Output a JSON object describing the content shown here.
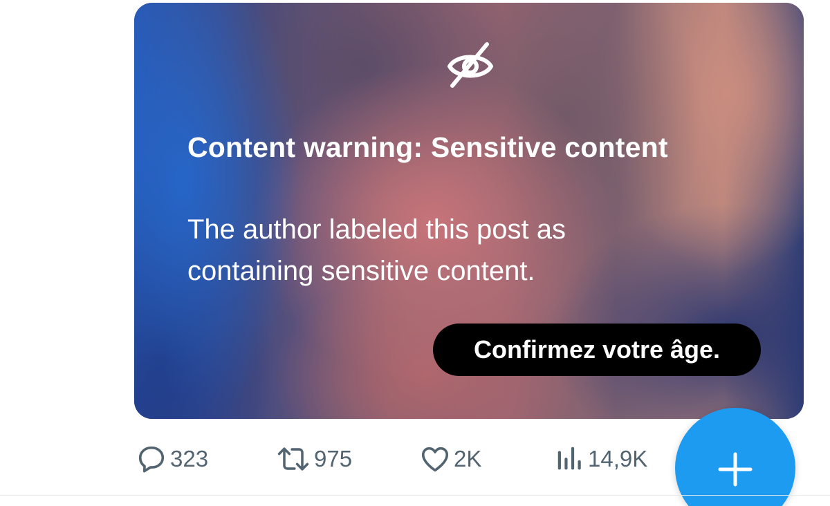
{
  "media": {
    "warning_title": "Content warning: Sensitive content",
    "warning_body": "The author labeled this post as containing sensitive content.",
    "confirm_age_label": "Confirmez votre âge.",
    "icon": "eye-slash-icon"
  },
  "actions": {
    "replies": {
      "icon": "reply-icon",
      "count": "323"
    },
    "reposts": {
      "icon": "repost-icon",
      "count": "975"
    },
    "likes": {
      "icon": "heart-icon",
      "count": "2K"
    },
    "views": {
      "icon": "views-chart-icon",
      "count": "14,9K"
    }
  },
  "compose": {
    "icon": "plus-icon"
  },
  "colors": {
    "accent": "#1d9bf0",
    "action_gray": "#536471",
    "button_black": "#000000"
  }
}
